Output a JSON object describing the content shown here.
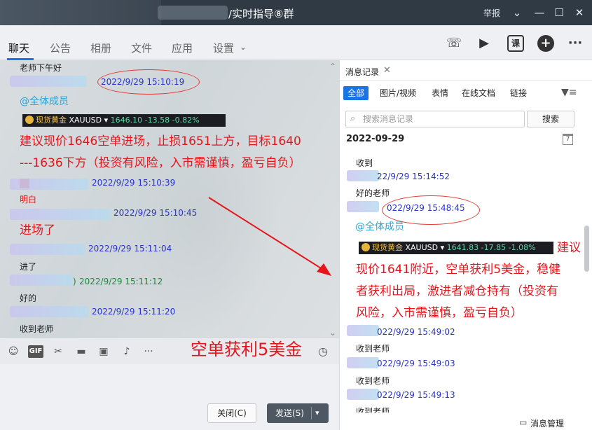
{
  "window": {
    "title": "/实时指导⑧群",
    "report_label": "举报",
    "controls": {
      "menu": "⌄",
      "minimize": "—",
      "maximize": "☐",
      "close": "✕"
    }
  },
  "tabs": [
    {
      "label": "聊天",
      "active": true
    },
    {
      "label": "公告"
    },
    {
      "label": "相册"
    },
    {
      "label": "文件"
    },
    {
      "label": "应用"
    },
    {
      "label": "设置"
    }
  ],
  "tab_settings_arrow": "⌄",
  "toolbar_right": {
    "phone_icon": "☏",
    "video_icon": "▶",
    "lesson_label": "课",
    "add_icon": "+",
    "more_icon": "···"
  },
  "chat": {
    "top_text": "老师下午好",
    "m1_time": "2022/9/29 15:10:19",
    "m1_mention": "@全体成员",
    "ticker1": {
      "name": "现货黄金",
      "symbol": "XAUUSD",
      "arrow": "▾",
      "price": "1646.10",
      "change": "-13.58",
      "pct": "-0.82%"
    },
    "m1_line1": "建议现价1646空单进场，止损1651上方，目标1640",
    "m1_line2": "---1636下方（投资有风险，入市需谨慎，盈亏自负）",
    "m2_time": "2022/9/29 15:10:39",
    "m2_text": "明白",
    "m3_time": "2022/9/29 15:10:45",
    "m3_text": "进场了",
    "m4_time": "2022/9/29 15:11:04",
    "m4_text": "进了",
    "m5_time_prefix": ")",
    "m5_time": "2022/9/29 15:11:12",
    "m5_text": "好的",
    "m6_time": "2022/9/29 15:11:20",
    "m6_text": "收到老师",
    "collapse_up": "⌃",
    "collapse_down": "⌄",
    "overlay": "空单获利5美金"
  },
  "input_toolbar": {
    "emoji_icon": "☺",
    "gif_label": "GIF",
    "scissors_icon": "✂",
    "folder_icon": "▬",
    "image_icon": "▣",
    "bell_icon": "♪",
    "more_icon": "···",
    "clock_icon": "◷"
  },
  "buttons": {
    "close": "关闭(C)",
    "send": "发送(S)",
    "send_dropdown": "▾"
  },
  "history": {
    "tab_label": "消息记录",
    "tab_close": "✕",
    "filters": [
      "全部",
      "图片/视频",
      "表情",
      "在线文档",
      "链接"
    ],
    "filter_icon": "▼≡",
    "search_placeholder": "搜索消息记录",
    "search_button": "搜索",
    "date": "2022-09-29",
    "calendar_label": "7",
    "h1_text": "收到",
    "h1_time": "2022/9/29 15:14:52",
    "h1_time_visible": "22/9/29 15:14:52",
    "h2_text": "好的老师",
    "h2_time_visible": "022/9/29 15:48:45",
    "h2_mention": "@全体成员",
    "ticker2": {
      "name": "现货黄金",
      "symbol": "XAUUSD",
      "arrow": "▾",
      "price": "1641.83",
      "change": "-17.85",
      "pct": "-1.08%"
    },
    "h2_red1": "建议",
    "h2_red2": "现价1641附近，空单获利5美金，稳健",
    "h2_red3": "者获利出局，激进者减仓持有（投资有",
    "h2_red4": "风险，入市需谨慎，盈亏自负）",
    "h3_time_visible": "022/9/29 15:49:02",
    "h3_text": "收到老师",
    "h4_time_visible": "022/9/29 15:49:03",
    "h4_text": "收到老师",
    "h5_time_visible": "022/9/29 15:49:13",
    "h5_text": "收到老师",
    "manage_label": "消息管理",
    "manage_icon": "▭"
  }
}
